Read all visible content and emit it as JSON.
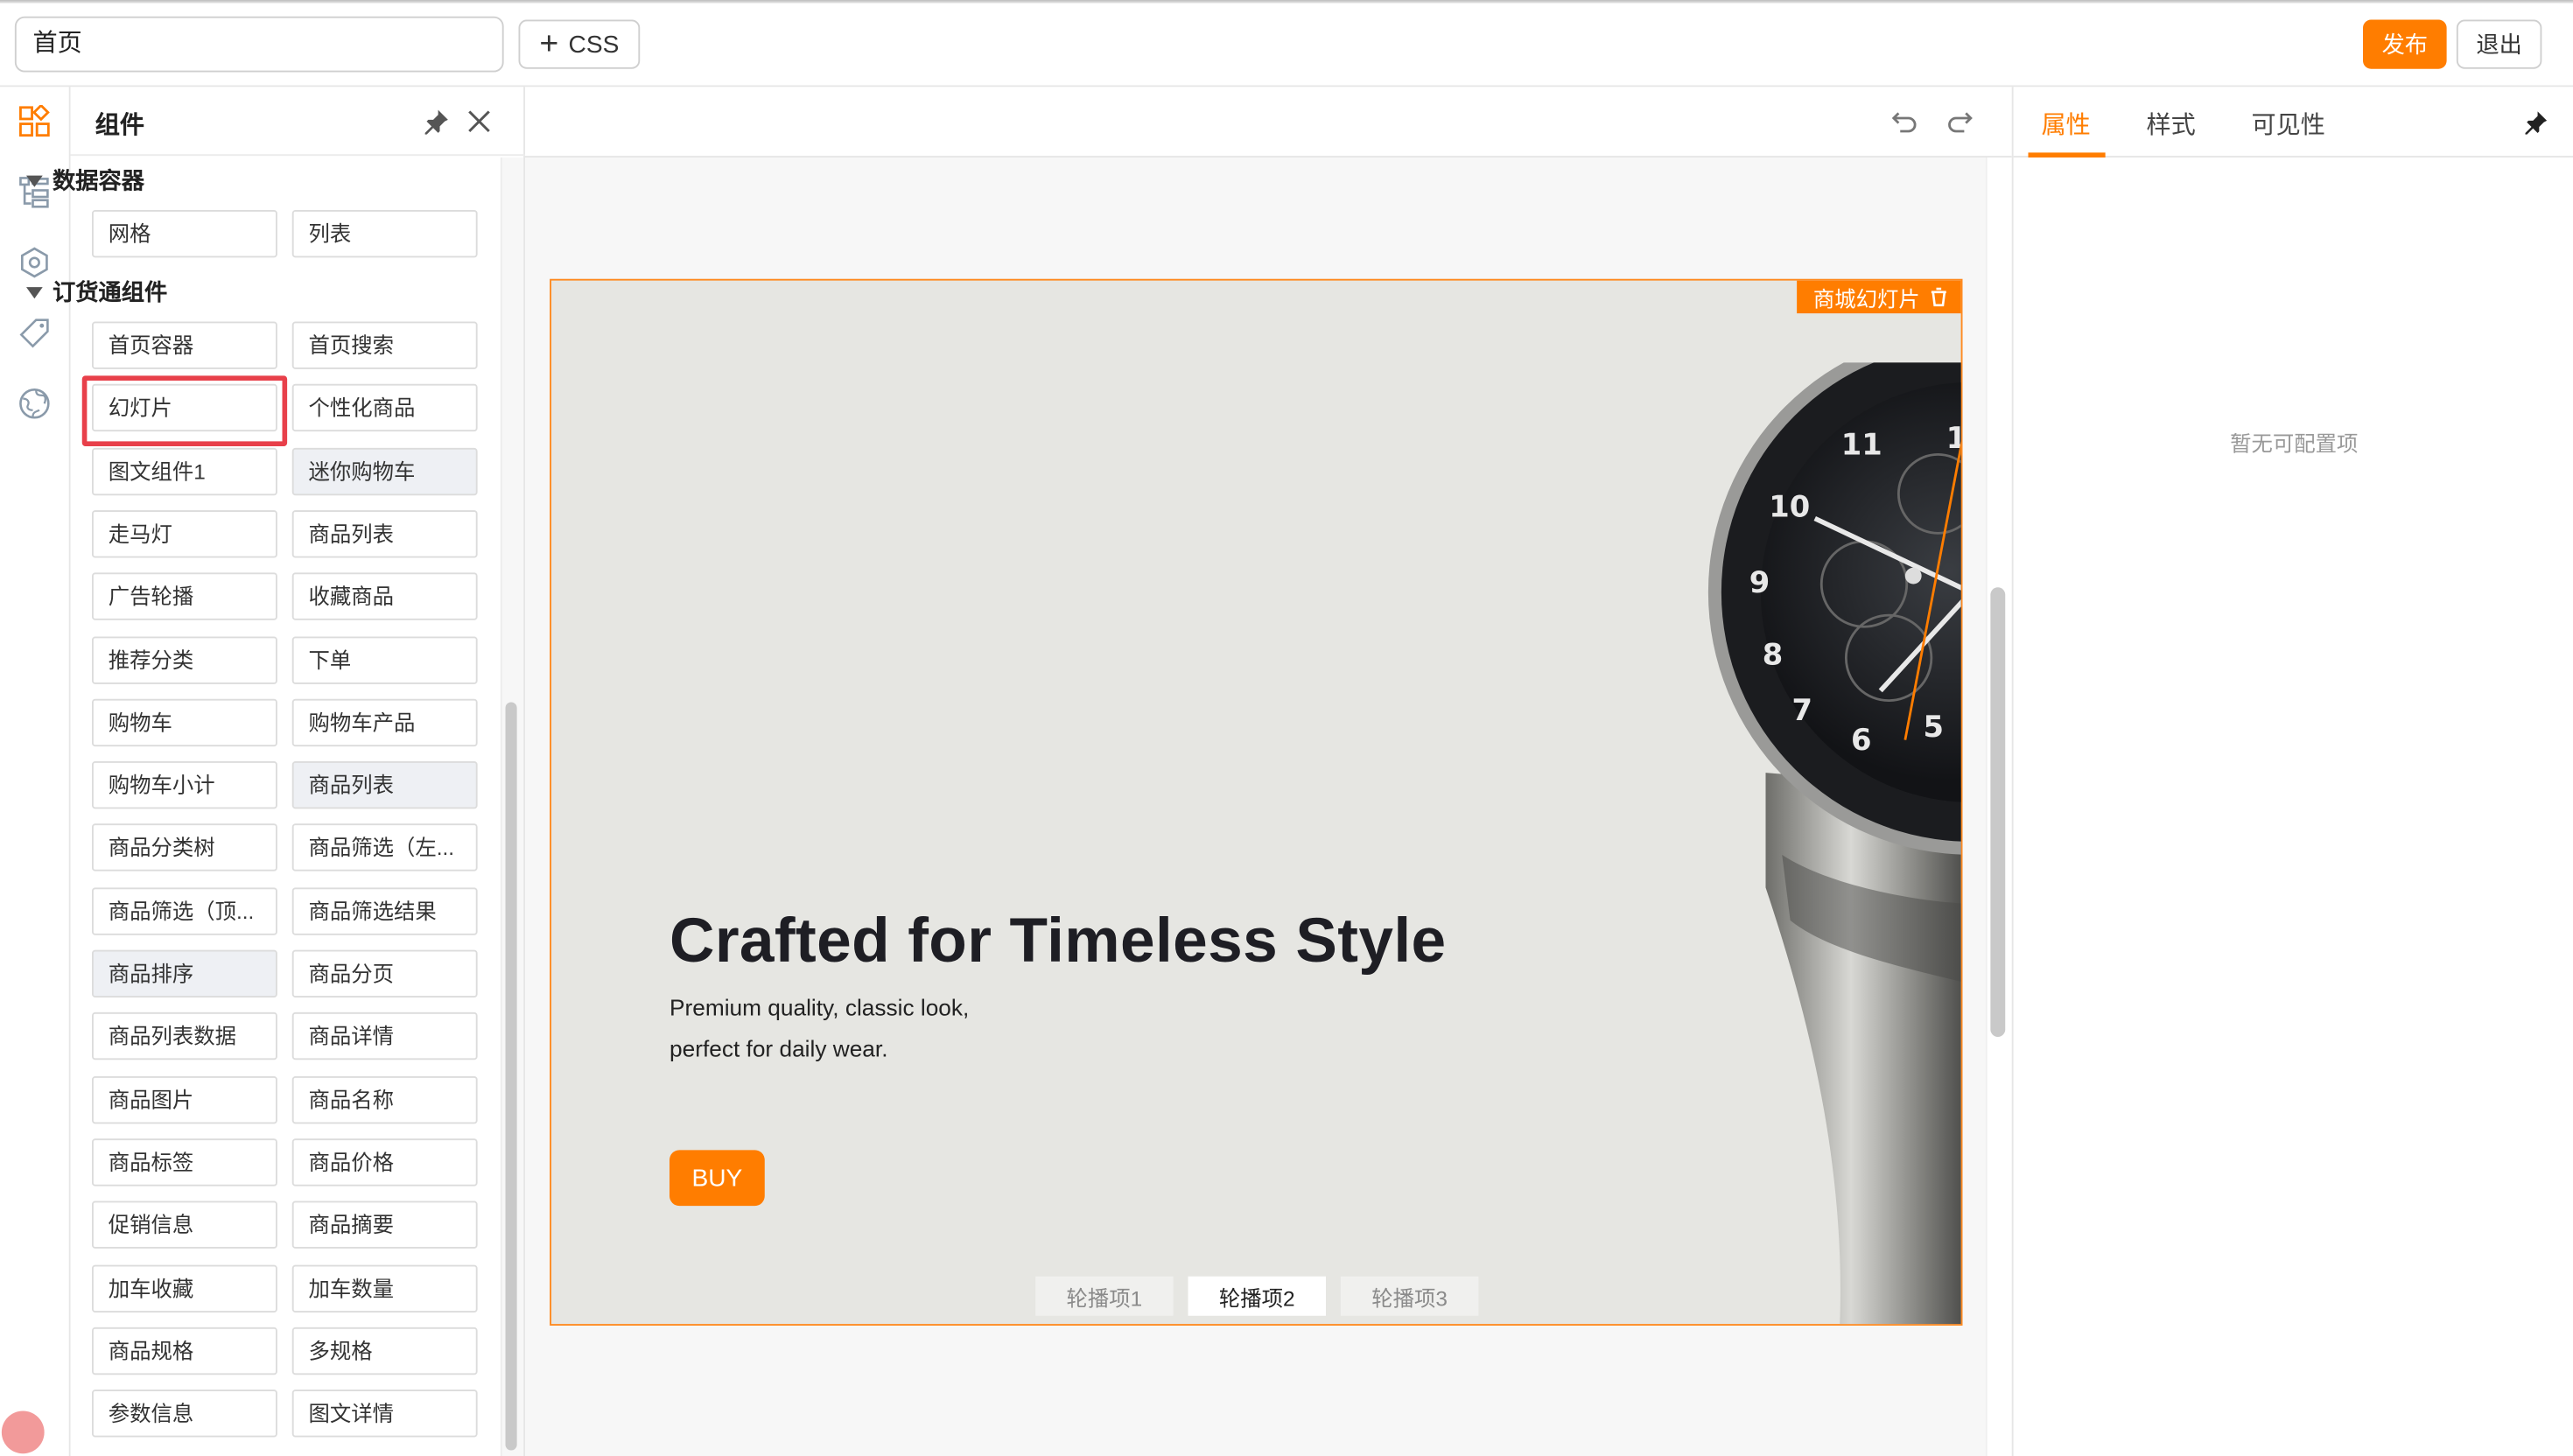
{
  "topbar": {
    "page_name": "首页",
    "css_label": "CSS",
    "publish_label": "发布",
    "exit_label": "退出"
  },
  "rail": {
    "icons": [
      "components-icon",
      "tree-icon",
      "settings-icon",
      "tag-icon",
      "globe-icon"
    ]
  },
  "components": {
    "title": "组件",
    "sections": [
      {
        "title": "数据容器",
        "items": [
          "网格",
          "列表"
        ]
      },
      {
        "title": "订货通组件",
        "items": [
          "首页容器",
          "首页搜索",
          "幻灯片",
          "个性化商品",
          "图文组件1",
          "迷你购物车",
          "走马灯",
          "商品列表",
          "广告轮播",
          "收藏商品",
          "推荐分类",
          "下单",
          "购物车",
          "购物车产品",
          "购物车小计",
          "商品列表",
          "商品分类树",
          "商品筛选（左...",
          "商品筛选（顶...",
          "商品筛选结果",
          "商品排序",
          "商品分页",
          "商品列表数据",
          "商品详情",
          "商品图片",
          "商品名称",
          "商品标签",
          "商品价格",
          "促销信息",
          "商品摘要",
          "加车收藏",
          "加车数量",
          "商品规格",
          "多规格",
          "参数信息",
          "图文详情"
        ]
      }
    ],
    "selected_item": "幻灯片"
  },
  "slide": {
    "tag_label": "商城幻灯片",
    "title": "Crafted for Timeless Style",
    "subtitle_line1": "Premium quality, classic look,",
    "subtitle_line2": "perfect for daily wear.",
    "button_label": "BUY",
    "tabs": [
      "轮播项1",
      "轮播项2",
      "轮播项3"
    ],
    "active_tab": "轮播项2",
    "accent_color": "#ff7d00"
  },
  "right_panel": {
    "tabs": [
      "属性",
      "样式",
      "可见性"
    ],
    "active_tab": "属性",
    "empty_text": "暂无可配置项"
  }
}
